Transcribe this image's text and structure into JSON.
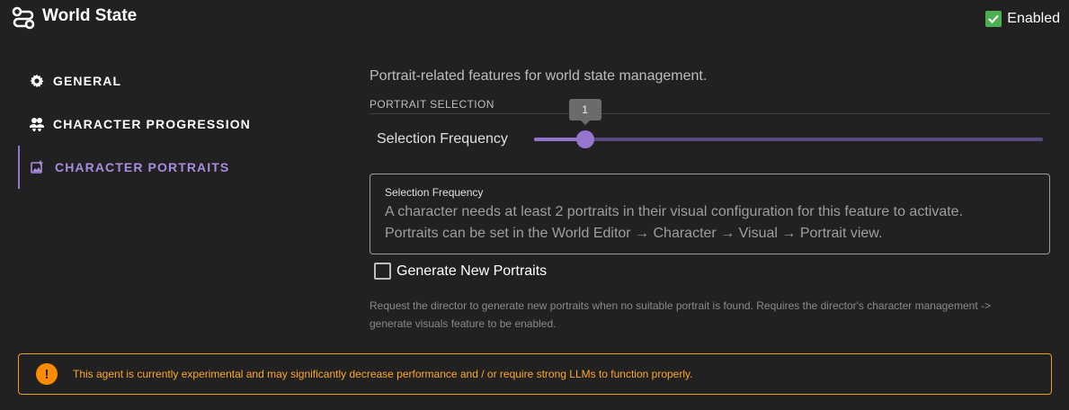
{
  "header": {
    "title": "World State",
    "enabled_label": "Enabled",
    "enabled_checked": true,
    "title_icon": "route-icon"
  },
  "nav": {
    "items": [
      {
        "label": "GENERAL",
        "icon": "gear-icon",
        "active": false
      },
      {
        "label": "CHARACTER PROGRESSION",
        "icon": "people-icon",
        "active": false
      },
      {
        "label": "CHARACTER PORTRAITS",
        "icon": "image-plus-icon",
        "active": true
      }
    ]
  },
  "main": {
    "description": "Portrait-related features for world state management.",
    "section_label": "PORTRAIT SELECTION",
    "slider": {
      "label": "Selection Frequency",
      "value": "1",
      "fraction": 0.1
    },
    "info": {
      "title": "Selection Frequency",
      "line1": "A character needs at least 2 portraits in their visual configuration for this feature to activate.",
      "line2": "Portraits can be set in the World Editor → Character → Visual → Portrait view."
    },
    "generate": {
      "label": "Generate New Portraits",
      "checked": false
    },
    "hint_line1": "Request the director to generate new portraits when no suitable portrait is found. Requires the director's character management ->",
    "hint_line2": "generate visuals feature to be enabled."
  },
  "warning": {
    "icon": "exclamation-icon",
    "symbol": "!",
    "text": "This agent is currently experimental and may significantly decrease performance and / or require strong LLMs to function properly."
  },
  "colors": {
    "accent": "#9575cd",
    "enabled_green": "#4caf50",
    "warning": "#fb8c00"
  }
}
